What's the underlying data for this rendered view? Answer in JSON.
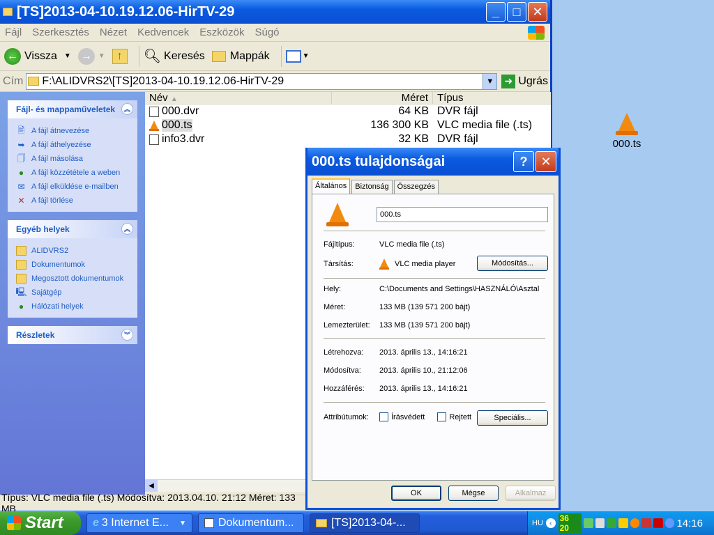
{
  "explorer": {
    "title": "[TS]2013-04-10.19.12.06-HirTV-29",
    "menu": [
      "Fájl",
      "Szerkesztés",
      "Nézet",
      "Kedvencek",
      "Eszközök",
      "Súgó"
    ],
    "toolbar": {
      "back": "Vissza",
      "search": "Keresés",
      "folders": "Mappák"
    },
    "address": {
      "label": "Cím",
      "value": "F:\\ALIDVRS2\\[TS]2013-04-10.19.12.06-HirTV-29",
      "go": "Ugrás"
    },
    "taskpane": {
      "file_tasks": {
        "title": "Fájl- és mappaműveletek",
        "items": [
          "A fájl átnevezése",
          "A fájl áthelyezése",
          "A fájl másolása",
          "A fájl közzététele a weben",
          "A fájl elküldése e-mailben",
          "A fájl törlése"
        ]
      },
      "other_places": {
        "title": "Egyéb helyek",
        "items": [
          "ALIDVRS2",
          "Dokumentumok",
          "Megosztott dokumentumok",
          "Sajátgép",
          "Hálózati helyek"
        ]
      },
      "details": {
        "title": "Részletek"
      }
    },
    "columns": {
      "name": "Név",
      "size": "Méret",
      "type": "Típus"
    },
    "files": [
      {
        "name": "000.dvr",
        "size": "64 KB",
        "type": "DVR fájl",
        "icon": "dvr-file-icon"
      },
      {
        "name": "000.ts",
        "size": "136 300 KB",
        "type": "VLC media file (.ts)",
        "icon": "vlc-cone-icon"
      },
      {
        "name": "info3.dvr",
        "size": "32 KB",
        "type": "DVR fájl",
        "icon": "dvr-file-icon"
      }
    ],
    "status": "Típus: VLC media file (.ts) Módosítva: 2013.04.10. 21:12 Méret: 133 MB"
  },
  "desktop_icon": {
    "label": "000.ts"
  },
  "dialog": {
    "title": "000.ts tulajdonságai",
    "tabs": [
      "Általános",
      "Biztonság",
      "Összegzés"
    ],
    "filename": "000.ts",
    "filetype_label": "Fájltípus:",
    "filetype_value": "VLC media file (.ts)",
    "assoc_label": "Társítás:",
    "assoc_value": "VLC media player",
    "change_button": "Módosítás...",
    "location_label": "Hely:",
    "location_value": "C:\\Documents and Settings\\HASZNÁLÓ\\Asztal",
    "size_label": "Méret:",
    "size_value": "133 MB (139 571 200 bájt)",
    "disk_label": "Lemezterület:",
    "disk_value": "133 MB (139 571 200 bájt)",
    "created_label": "Létrehozva:",
    "created_value": "2013. április 13., 14:16:21",
    "modified_label": "Módosítva:",
    "modified_value": "2013. április 10., 21:12:06",
    "accessed_label": "Hozzáférés:",
    "accessed_value": "2013. április 13., 14:16:21",
    "attr_label": "Attribútumok:",
    "readonly": "Írásvédett",
    "hidden": "Rejtett",
    "special_button": "Speciális...",
    "ok": "OK",
    "cancel": "Mégse",
    "apply": "Alkalmaz"
  },
  "taskbar": {
    "start": "Start",
    "tasks": [
      "3 Internet E...",
      "Dokumentum...",
      "[TS]2013-04-..."
    ],
    "lang": "HU",
    "tray_badge": "36 20",
    "clock": "14:16"
  }
}
